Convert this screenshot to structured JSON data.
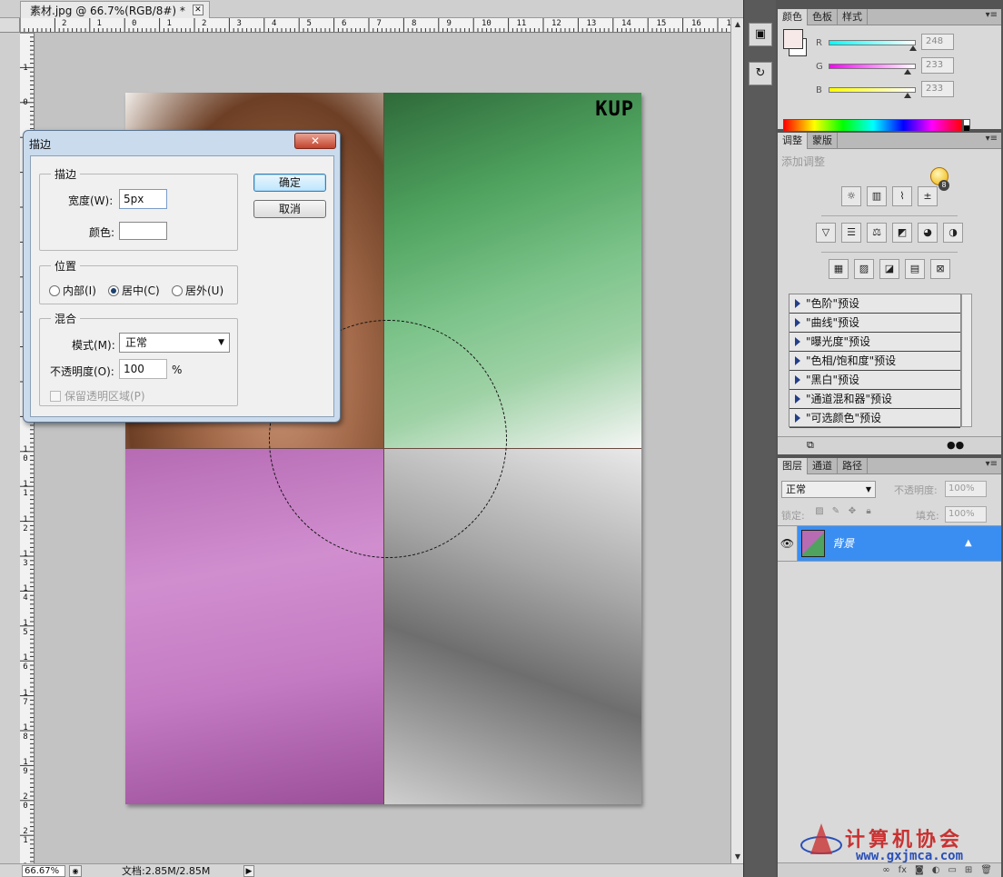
{
  "document": {
    "tab_title": "素材.jpg @ 66.7%(RGB/8#) *",
    "tab_close": "✕",
    "ruler_h_labels": [
      "2",
      "1",
      "0",
      "1",
      "2",
      "3",
      "4",
      "5",
      "6",
      "7",
      "8",
      "9",
      "10",
      "11",
      "12",
      "13",
      "14",
      "15",
      "16",
      "17"
    ],
    "ruler_v_labels": [
      "1",
      "0",
      "1",
      "2",
      "3",
      "4",
      "5",
      "6",
      "7",
      "8",
      "9",
      "1 0",
      "1 1",
      "1 2",
      "1 3",
      "1 4",
      "1 5",
      "1 6",
      "1 7",
      "1 8",
      "1 9",
      "2 0",
      "2 1",
      "2 2"
    ],
    "photo_logo": "KUP",
    "zoom": "66.67%",
    "doc_size": "文档:2.85M/2.85M"
  },
  "dialog": {
    "title": "描边",
    "close": "✕",
    "stroke_group": "描边",
    "width_label": "宽度(W):",
    "width_value": "5px",
    "color_label": "颜色:",
    "position_group": "位置",
    "pos_inside": "内部(I)",
    "pos_center": "居中(C)",
    "pos_outside": "居外(U)",
    "blend_group": "混合",
    "mode_label": "模式(M):",
    "mode_value": "正常",
    "opacity_label": "不透明度(O):",
    "opacity_value": "100",
    "opacity_unit": "%",
    "preserve_label": "保留透明区域(P)",
    "ok": "确定",
    "cancel": "取消"
  },
  "color_panel": {
    "tabs": [
      "颜色",
      "色板",
      "样式"
    ],
    "menu": "▾≡",
    "channels": [
      {
        "label": "R",
        "value": "248",
        "fraction": 0.97,
        "gradient": "linear-gradient(90deg,#00ffff,#ffffff)"
      },
      {
        "label": "G",
        "value": "233",
        "fraction": 0.91,
        "gradient": "linear-gradient(90deg,#ff00ff,#ffffff)"
      },
      {
        "label": "B",
        "value": "233",
        "fraction": 0.91,
        "gradient": "linear-gradient(90deg,#ffff00,#ffffff)"
      }
    ],
    "foreground": "#f8e9e9",
    "background": "#ffffff"
  },
  "adjust_panel": {
    "tabs": [
      "调整",
      "蒙版"
    ],
    "menu": "▾≡",
    "title": "添加调整",
    "bulb_count": "8",
    "row1": [
      "☼",
      "▥",
      "⌇",
      "±"
    ],
    "row2": [
      "▽",
      "☰",
      "⚖",
      "◩",
      "◕",
      "◑"
    ],
    "row3": [
      "▦",
      "▨",
      "◪",
      "▤",
      "⊠"
    ],
    "presets": [
      "\"色阶\"预设",
      "\"曲线\"预设",
      "\"曝光度\"预设",
      "\"色相/饱和度\"预设",
      "\"黑白\"预设",
      "\"通道混和器\"预设",
      "\"可选颜色\"预设"
    ]
  },
  "layers_panel": {
    "tabs": [
      "图层",
      "通道",
      "路径"
    ],
    "menu": "▾≡",
    "blend_mode": "正常",
    "opacity_label": "不透明度:",
    "opacity_value": "100%",
    "lock_label": "锁定:",
    "fill_label": "填充:",
    "fill_value": "100%",
    "layer_name": "背景",
    "footer_icons": [
      "∞",
      "fx",
      "◙",
      "◐",
      "▭",
      "⊞",
      "🗑"
    ]
  },
  "watermark": {
    "title": "计算机协会",
    "url": "www.gxjmca.com"
  }
}
